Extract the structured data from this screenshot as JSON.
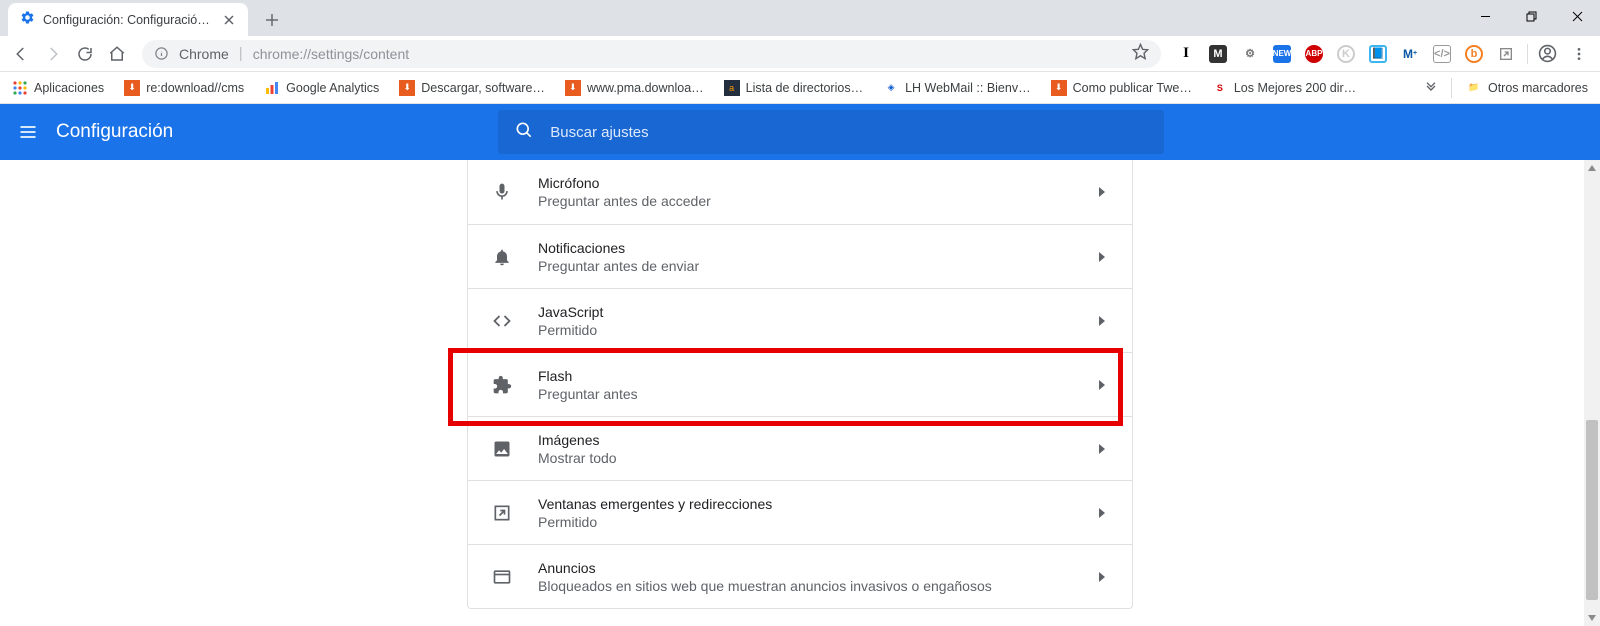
{
  "window": {
    "tab_title": "Configuración: Configuración de"
  },
  "omnibox": {
    "prefix": "Chrome",
    "url": "chrome://settings/content"
  },
  "bookmarks": {
    "apps": "Aplicaciones",
    "items": [
      "re:download//cms",
      "Google Analytics",
      "Descargar, software…",
      "www.pma.downloa…",
      "Lista de directorios…",
      "LH WebMail :: Bienv…",
      "Como publicar Twe…",
      "Los Mejores 200 dir…"
    ],
    "other": "Otros marcadores"
  },
  "app": {
    "title": "Configuración",
    "search_placeholder": "Buscar ajustes"
  },
  "rows": {
    "mic": {
      "title": "Micrófono",
      "sub": "Preguntar antes de acceder"
    },
    "notif": {
      "title": "Notificaciones",
      "sub": "Preguntar antes de enviar"
    },
    "js": {
      "title": "JavaScript",
      "sub": "Permitido"
    },
    "flash": {
      "title": "Flash",
      "sub": "Preguntar antes"
    },
    "img": {
      "title": "Imágenes",
      "sub": "Mostrar todo"
    },
    "popup": {
      "title": "Ventanas emergentes y redirecciones",
      "sub": "Permitido"
    },
    "ads": {
      "title": "Anuncios",
      "sub": "Bloqueados en sitios web que muestran anuncios invasivos o engañosos"
    }
  }
}
